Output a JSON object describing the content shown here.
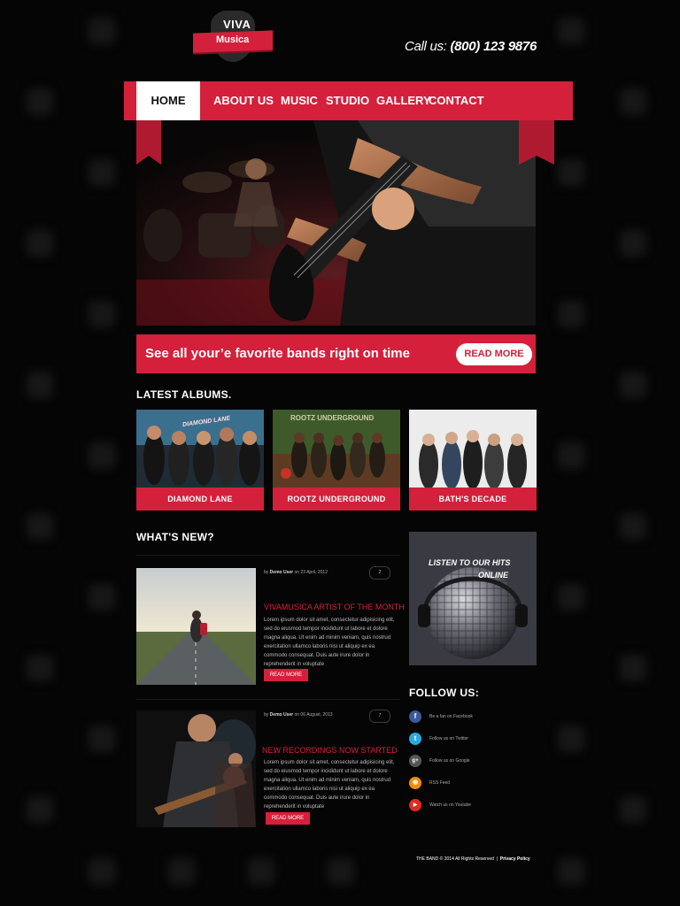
{
  "brand": {
    "line1": "VIVA",
    "line2": "Musica"
  },
  "phone": {
    "prefix": "Call us:",
    "number": "(800) 123 9876"
  },
  "nav": {
    "items": [
      "HOME",
      "ABOUT US",
      "MUSIC",
      "STUDIO",
      "GALLERY",
      "CONTACT"
    ],
    "active": "HOME"
  },
  "cta": {
    "text": "See all your’e favorite bands right on time",
    "button": "READ MORE"
  },
  "albums": {
    "heading": "LATEST ALBUMS.",
    "items": [
      {
        "title": "DIAMOND LANE",
        "photo_text": "DIAMOND LANE"
      },
      {
        "title": "ROOTZ UNDERGROUND",
        "photo_text": "ROOTZ UNDERGROUND"
      },
      {
        "title": "BATH'S DECADE"
      }
    ]
  },
  "news": {
    "heading": "WHAT'S NEW?",
    "posts": [
      {
        "by": "by",
        "author": "Demo User",
        "on": "on 23 April, 2012",
        "comments": "2",
        "title": "VIVAMUSICA ARTIST OF THE MONTH",
        "body": "Lorem ipsum dolor sit amet, consectetur adipisicing elit, sed do eiusmod tempor incididunt ut labore et dolore magna aliqua. Ut enim ad minim veniam, quis nostrud exercitation ullamco laboris nisi ut aliquip ex ea commodo consequat. Duis aute irure dolor in reprehenderit in voluptate",
        "button": "READ MORE"
      },
      {
        "by": "by",
        "author": "Demo User",
        "on": "on 06 August, 2013",
        "comments": "7",
        "title": "NEW RECORDINGS NOW STARTED",
        "body": "Lorem ipsum dolor sit amet, consectetur adipisicing elit, sed do eiusmod tempor incididunt ut labore et dolore magna aliqua. Ut enim ad minim veniam, quis nostrud exercitation ullamco laboris nisi ut aliquip ex ea commodo consequat. Duis aute irure dolor in reprehenderit in voluptate",
        "button": "READ MORE"
      }
    ]
  },
  "widget": {
    "line1": "LISTEN TO OUR HITS",
    "line2": "ONLINE"
  },
  "follow": {
    "heading": "FOLLOW US:",
    "items": [
      {
        "icon": "facebook-icon",
        "glyph": "f",
        "color": "#3b5998",
        "text": "Be a fan on Facebook"
      },
      {
        "icon": "twitter-icon",
        "glyph": "t",
        "color": "#29a9e1",
        "text": "Follow us on Twitter"
      },
      {
        "icon": "google-plus-icon",
        "glyph": "g+",
        "color": "#555555",
        "text": "Follow us on Google"
      },
      {
        "icon": "rss-icon",
        "glyph": "◉",
        "color": "#f38b00",
        "text": "RSS Feed"
      },
      {
        "icon": "youtube-icon",
        "glyph": "▶",
        "color": "#e02a20",
        "text": "Watch us on Youtube"
      }
    ]
  },
  "footer": {
    "text": "THE BAND © 2014 All Rights Reserved",
    "separator": "|",
    "link": "Privacy Policy"
  },
  "colors": {
    "accent": "#d4203b",
    "background": "#050505"
  }
}
